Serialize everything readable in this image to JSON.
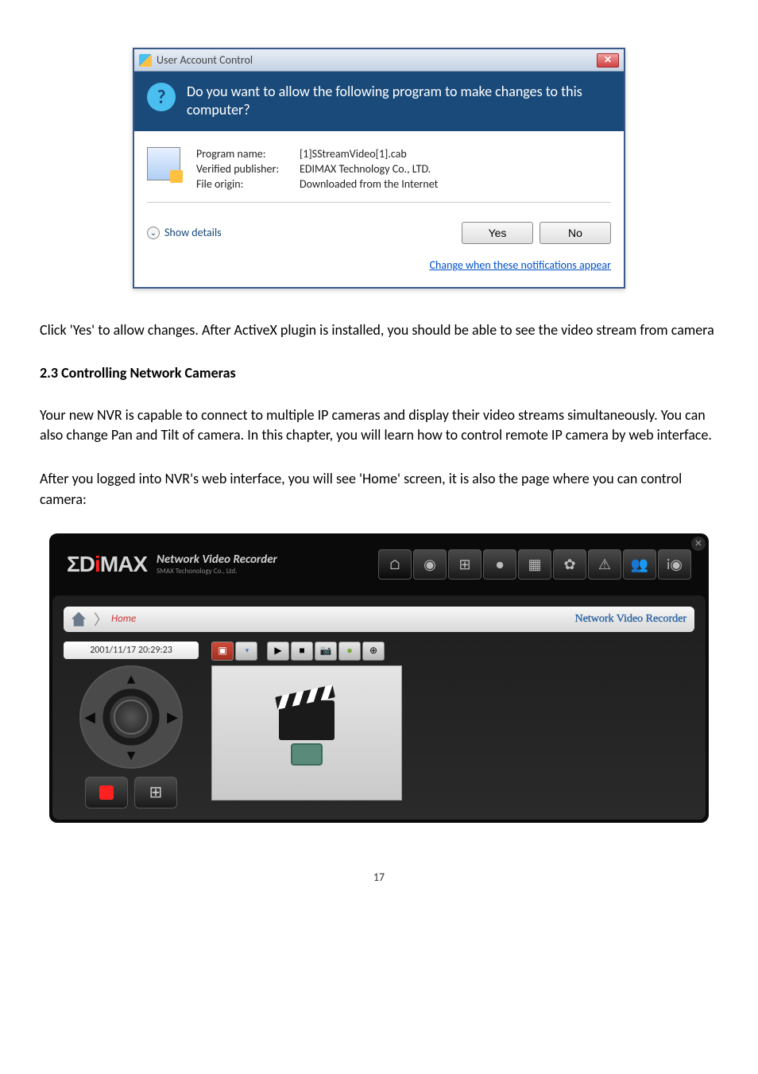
{
  "uac": {
    "title": "User Account Control",
    "question": "Do you want to allow the following program to make changes to this computer?",
    "program_name_label": "Program name:",
    "program_name": "[1]SStreamVideo[1].cab",
    "publisher_label": "Verified publisher:",
    "publisher": "EDIMAX Technology Co., LTD.",
    "origin_label": "File origin:",
    "origin": "Downloaded from the Internet",
    "show_details": "Show details",
    "yes": "Yes",
    "no": "No",
    "change_link": "Change when these notifications appear"
  },
  "body": {
    "para1": "Click 'Yes' to allow changes. After ActiveX plugin is installed, you should be able to see the video stream from camera",
    "heading": "2.3 Controlling Network Cameras",
    "para2": "Your new NVR is capable to connect to multiple IP cameras and display their video streams simultaneously. You can also change Pan and Tilt of camera. In this chapter, you will learn how to control remote IP camera by web interface.",
    "para3": "After you logged into NVR's web interface, you will see 'Home' screen, it is also the page where you can control camera:"
  },
  "nvr": {
    "logo_main": "ΣDIMAX",
    "logo_line1": "Network Video Recorder",
    "logo_line2": "SMAX Techonology Co., Ltd.",
    "breadcrumb": "Home",
    "slogan": "Network Video Recorder",
    "timestamp": "2001/11/17 20:29:23"
  },
  "page_number": "17"
}
